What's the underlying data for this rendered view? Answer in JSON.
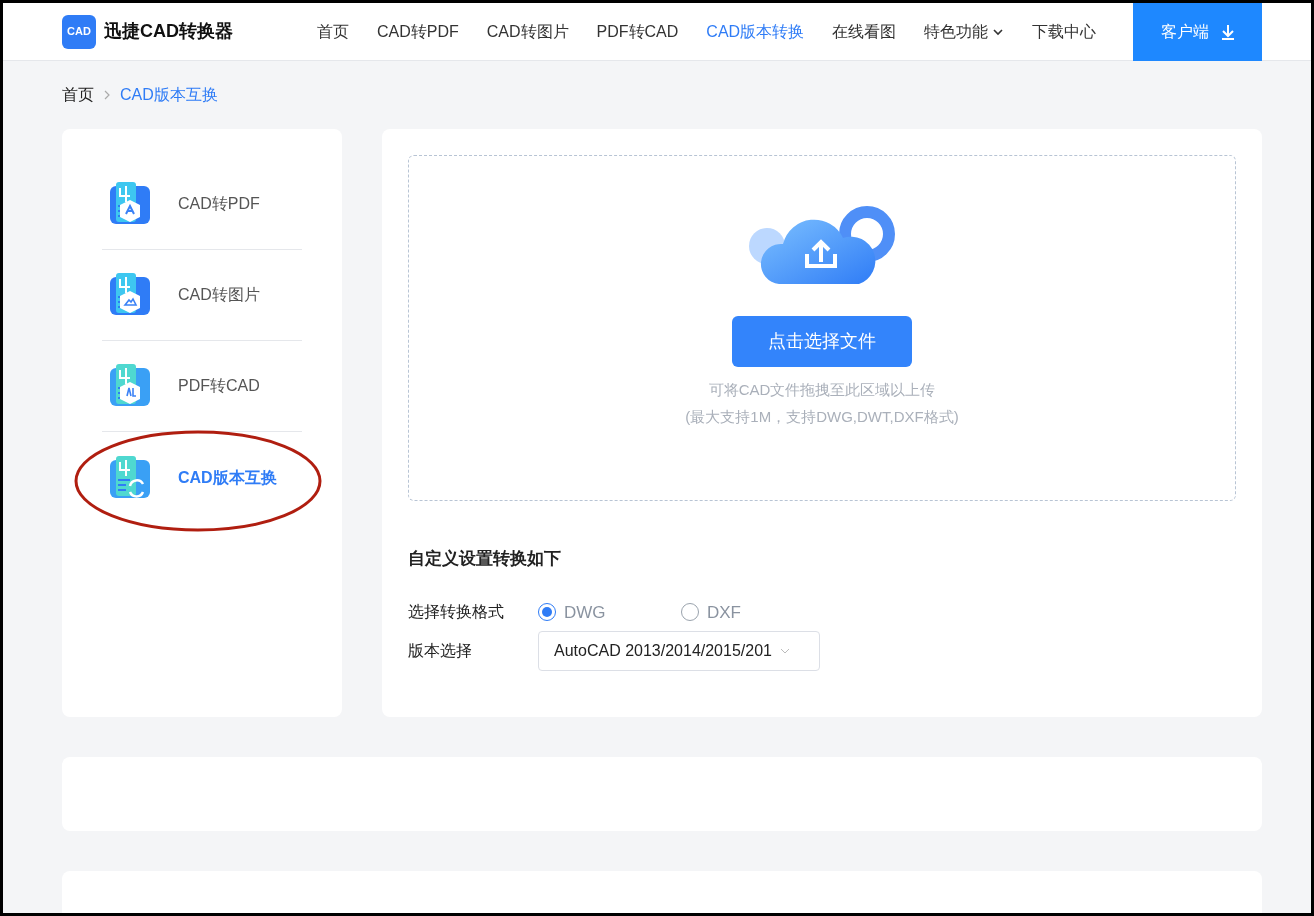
{
  "header": {
    "logo_badge": "CAD",
    "brand": "迅捷CAD转换器",
    "nav": [
      {
        "label": "首页",
        "selected": false,
        "dropdown": false
      },
      {
        "label": "CAD转PDF",
        "selected": false,
        "dropdown": false
      },
      {
        "label": "CAD转图片",
        "selected": false,
        "dropdown": false
      },
      {
        "label": "PDF转CAD",
        "selected": false,
        "dropdown": false
      },
      {
        "label": "CAD版本转换",
        "selected": true,
        "dropdown": false
      },
      {
        "label": "在线看图",
        "selected": false,
        "dropdown": false
      },
      {
        "label": "特色功能",
        "selected": false,
        "dropdown": true
      },
      {
        "label": "下载中心",
        "selected": false,
        "dropdown": false
      }
    ],
    "client_button": "客户端"
  },
  "breadcrumb": [
    "首页",
    "CAD版本互换"
  ],
  "sidebar": {
    "items": [
      {
        "label": "CAD转PDF",
        "kind": "pdf",
        "selected": false,
        "circled": false
      },
      {
        "label": "CAD转图片",
        "kind": "image",
        "selected": false,
        "circled": false
      },
      {
        "label": "PDF转CAD",
        "kind": "cad",
        "selected": false,
        "circled": false
      },
      {
        "label": "CAD版本互换",
        "kind": "swap",
        "selected": true,
        "circled": true
      }
    ]
  },
  "upload": {
    "button": "点击选择文件",
    "hint": "可将CAD文件拖拽至此区域以上传",
    "limits": "(最大支持1M，支持DWG,DWT,DXF格式)"
  },
  "settings": {
    "title": "自定义设置转换如下",
    "format_label": "选择转换格式",
    "formats": [
      {
        "label": "DWG",
        "selected": true
      },
      {
        "label": "DXF",
        "selected": false
      }
    ],
    "version_label": "版本选择",
    "version_value": "AutoCAD 2013/2014/2015/201"
  }
}
